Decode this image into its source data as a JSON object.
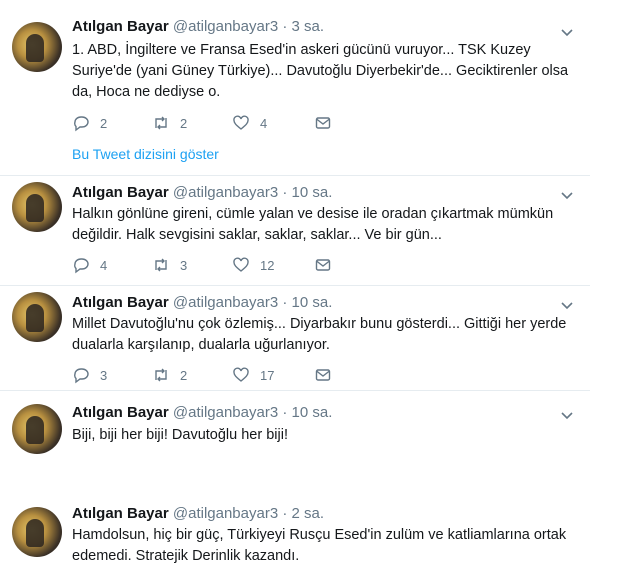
{
  "tweets": [
    {
      "name": "Atılgan Bayar",
      "handle": "@atilganbayar3",
      "dot": "·",
      "time": "3 sa.",
      "text": "1. ABD, İngiltere ve Fransa Esed'in askeri gücünü vuruyor... TSK Kuzey Suriye'de (yani Güney Türkiye)... Davutoğlu Diyerbekir'de... Geciktirenler olsa da, Hoca ne dediyse o.",
      "replies": "2",
      "retweets": "2",
      "likes": "4",
      "thread_link": "Bu Tweet dizisini göster"
    },
    {
      "name": "Atılgan Bayar",
      "handle": "@atilganbayar3",
      "dot": "·",
      "time": "10 sa.",
      "text": "Halkın gönlüne gireni, cümle yalan ve desise ile oradan çıkartmak mümkün değildir. Halk sevgisini saklar, saklar, saklar... Ve bir gün...",
      "replies": "4",
      "retweets": "3",
      "likes": "12"
    },
    {
      "name": "Atılgan Bayar",
      "handle": "@atilganbayar3",
      "dot": "·",
      "time": "10 sa.",
      "text": "Millet Davutoğlu'nu çok özlemiş... Diyarbakır bunu gösterdi... Gittiği her yerde dualarla karşılanıp, dualarla uğurlanıyor.",
      "replies": "3",
      "retweets": "2",
      "likes": "17"
    },
    {
      "name": "Atılgan Bayar",
      "handle": "@atilganbayar3",
      "dot": "·",
      "time": "10 sa.",
      "text": "Biji, biji her biji! Davutoğlu her biji!"
    },
    {
      "name": "Atılgan Bayar",
      "handle": "@atilganbayar3",
      "dot": "·",
      "time": "2 sa.",
      "text": "Hamdolsun, hiç bir güç, Türkiyeyi Rusçu Esed'in zulüm ve katliamlarına ortak edemedi. Stratejik Derinlik kazandı."
    }
  ]
}
